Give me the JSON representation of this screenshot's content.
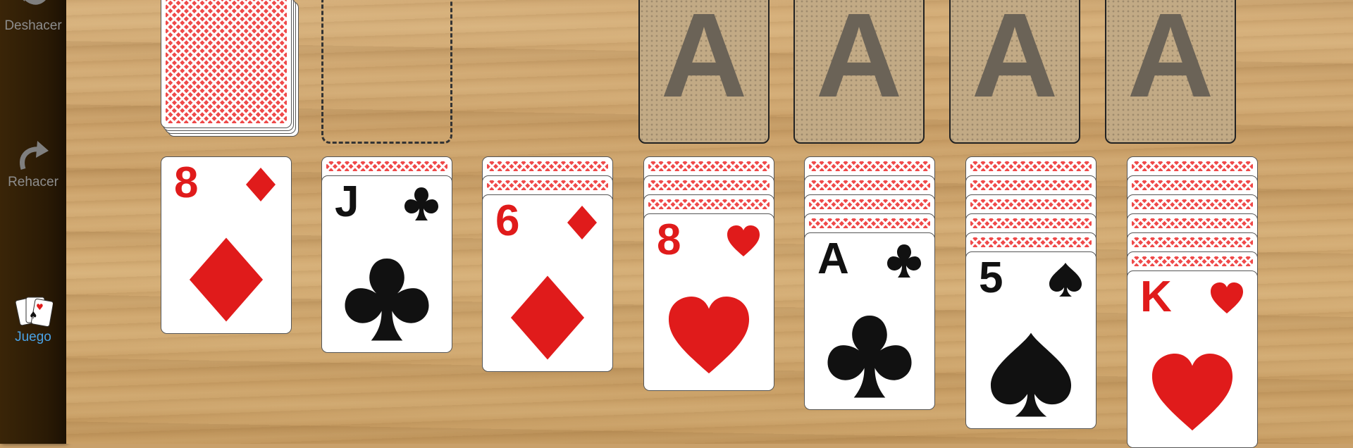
{
  "sidebar": {
    "undo_label": "Deshacer",
    "redo_label": "Rehacer",
    "game_label": "Juego"
  },
  "foundations": [
    "A",
    "A",
    "A",
    "A"
  ],
  "tableau": [
    {
      "hidden": 0,
      "top": {
        "rank": "8",
        "suit": "diamond",
        "color": "red"
      }
    },
    {
      "hidden": 1,
      "top": {
        "rank": "J",
        "suit": "club",
        "color": "black"
      }
    },
    {
      "hidden": 2,
      "top": {
        "rank": "6",
        "suit": "diamond",
        "color": "red"
      }
    },
    {
      "hidden": 3,
      "top": {
        "rank": "8",
        "suit": "heart",
        "color": "red"
      }
    },
    {
      "hidden": 4,
      "top": {
        "rank": "A",
        "suit": "club",
        "color": "black"
      }
    },
    {
      "hidden": 5,
      "top": {
        "rank": "5",
        "suit": "spade",
        "color": "black"
      }
    },
    {
      "hidden": 6,
      "top": {
        "rank": "K",
        "suit": "heart",
        "color": "red"
      }
    }
  ],
  "colors": {
    "red_suit": "#e01b1b",
    "black_suit": "#111111",
    "card_back": "#ef4a4a",
    "active_label": "#4aa3e6"
  }
}
